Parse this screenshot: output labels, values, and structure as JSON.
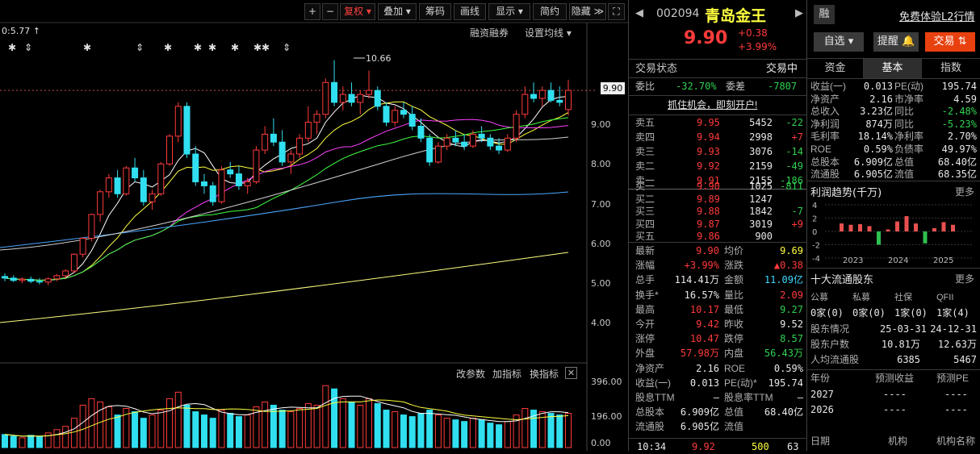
{
  "toolbar": {
    "plus": "+",
    "minus": "−",
    "buttons": [
      "复权",
      "叠加",
      "筹码",
      "画线",
      "显示",
      "简约",
      "隐藏"
    ],
    "expand_icon": "expand-icon"
  },
  "chart": {
    "max_label": "0:5.77",
    "peak_label": "10.66",
    "links": [
      "融资融券",
      "设置均线"
    ],
    "price_tag": "9.90",
    "y_ticks": [
      "9.00",
      "8.00",
      "7.00",
      "6.00",
      "5.00",
      "4.00"
    ],
    "volume_links": [
      "改参数",
      "加指标",
      "换指标"
    ],
    "volume_ticks": [
      "396.00",
      "196.00",
      "0.00"
    ],
    "candles": [
      [
        5.22,
        5.3,
        5.1,
        5.18
      ],
      [
        5.18,
        5.25,
        5.08,
        5.12
      ],
      [
        5.12,
        5.2,
        5.05,
        5.15
      ],
      [
        5.15,
        5.22,
        5.05,
        5.1
      ],
      [
        5.1,
        5.18,
        5.02,
        5.08
      ],
      [
        5.08,
        5.2,
        5.0,
        5.16
      ],
      [
        5.16,
        5.28,
        5.1,
        5.24
      ],
      [
        5.24,
        5.4,
        5.18,
        5.36
      ],
      [
        5.36,
        5.8,
        5.3,
        5.78
      ],
      [
        5.78,
        6.2,
        5.7,
        6.18
      ],
      [
        6.18,
        6.8,
        6.1,
        6.78
      ],
      [
        6.78,
        7.4,
        6.6,
        7.35
      ],
      [
        7.35,
        7.8,
        7.2,
        7.7
      ],
      [
        7.7,
        7.9,
        7.2,
        7.3
      ],
      [
        7.3,
        8.0,
        7.25,
        7.95
      ],
      [
        7.95,
        8.2,
        7.6,
        7.7
      ],
      [
        7.7,
        7.9,
        7.0,
        7.1
      ],
      [
        7.1,
        7.4,
        6.9,
        7.3
      ],
      [
        7.3,
        8.1,
        7.25,
        8.05
      ],
      [
        8.05,
        8.8,
        8.0,
        8.75
      ],
      [
        8.75,
        9.6,
        8.6,
        9.5
      ],
      [
        9.5,
        9.6,
        8.2,
        8.3
      ],
      [
        8.3,
        8.5,
        7.5,
        7.6
      ],
      [
        7.6,
        7.8,
        7.3,
        7.5
      ],
      [
        7.5,
        7.6,
        7.0,
        7.1
      ],
      [
        7.1,
        8.0,
        7.05,
        7.9
      ],
      [
        7.9,
        8.1,
        7.7,
        7.8
      ],
      [
        7.8,
        8.0,
        7.4,
        7.5
      ],
      [
        7.5,
        7.7,
        7.3,
        7.6
      ],
      [
        7.6,
        8.5,
        7.55,
        8.4
      ],
      [
        8.4,
        9.0,
        8.3,
        8.8
      ],
      [
        8.8,
        9.2,
        8.5,
        8.6
      ],
      [
        8.6,
        8.9,
        8.0,
        8.1
      ],
      [
        8.1,
        8.4,
        7.8,
        8.3
      ],
      [
        8.3,
        8.8,
        8.2,
        8.7
      ],
      [
        8.7,
        9.5,
        8.6,
        9.1
      ],
      [
        9.1,
        9.4,
        8.8,
        9.3
      ],
      [
        9.3,
        10.2,
        9.2,
        10.1
      ],
      [
        10.1,
        10.66,
        9.5,
        9.6
      ],
      [
        9.6,
        10.0,
        9.4,
        9.8
      ],
      [
        9.8,
        10.1,
        9.5,
        9.6
      ],
      [
        9.6,
        9.9,
        9.3,
        9.8
      ],
      [
        9.8,
        10.4,
        9.7,
        9.9
      ],
      [
        9.9,
        10.0,
        9.4,
        9.5
      ],
      [
        9.5,
        9.6,
        9.0,
        9.1
      ],
      [
        9.1,
        9.5,
        9.0,
        9.4
      ],
      [
        9.4,
        9.6,
        9.2,
        9.3
      ],
      [
        9.3,
        9.5,
        8.9,
        9.0
      ],
      [
        9.0,
        9.2,
        8.6,
        8.7
      ],
      [
        8.7,
        8.8,
        8.0,
        8.1
      ],
      [
        8.1,
        8.6,
        8.05,
        8.5
      ],
      [
        8.5,
        8.8,
        8.4,
        8.7
      ],
      [
        8.7,
        8.9,
        8.5,
        8.6
      ],
      [
        8.6,
        8.8,
        8.4,
        8.5
      ],
      [
        8.5,
        8.9,
        8.45,
        8.8
      ],
      [
        8.8,
        9.0,
        8.6,
        8.7
      ],
      [
        8.7,
        8.8,
        8.4,
        8.5
      ],
      [
        8.5,
        8.7,
        8.3,
        8.4
      ],
      [
        8.4,
        8.8,
        8.35,
        8.7
      ],
      [
        8.7,
        9.4,
        8.6,
        9.3
      ],
      [
        9.3,
        10.0,
        9.2,
        9.8
      ],
      [
        9.8,
        10.1,
        9.6,
        9.7
      ],
      [
        9.7,
        10.0,
        9.5,
        9.9
      ],
      [
        9.9,
        10.1,
        9.6,
        9.65
      ],
      [
        9.65,
        10.0,
        9.5,
        9.6
      ],
      [
        9.42,
        10.17,
        9.27,
        9.9
      ]
    ],
    "volumes": [
      80,
      70,
      60,
      75,
      65,
      90,
      110,
      130,
      180,
      260,
      300,
      280,
      250,
      200,
      240,
      220,
      180,
      200,
      230,
      300,
      340,
      260,
      220,
      200,
      180,
      230,
      210,
      190,
      200,
      250,
      280,
      260,
      230,
      220,
      240,
      270,
      260,
      380,
      360,
      300,
      280,
      260,
      300,
      270,
      230,
      220,
      200,
      190,
      210,
      230,
      200,
      180,
      170,
      160,
      180,
      170,
      150,
      140,
      160,
      200,
      240,
      230,
      220,
      210,
      200,
      210
    ]
  },
  "quote": {
    "code": "002094",
    "name": "青岛金王",
    "badge": "融",
    "l2_link": "免费体验L2行情",
    "price": "9.90",
    "change": "+0.38",
    "change_pct": "+3.99%",
    "buttons": [
      "自选",
      "提醒",
      "交易"
    ],
    "status_label": "交易状态",
    "status_value": "交易中",
    "wb_label": "委比",
    "wb_value": "-32.70%",
    "wc_label": "委差",
    "wc_value": "-7807",
    "promo": "抓住机会，即刻开户!",
    "asks": [
      {
        "label": "卖五",
        "price": "9.95",
        "vol": "5452",
        "delta": "-22"
      },
      {
        "label": "卖四",
        "price": "9.94",
        "vol": "2998",
        "delta": "+7"
      },
      {
        "label": "卖三",
        "price": "9.93",
        "vol": "3076",
        "delta": "-14"
      },
      {
        "label": "卖二",
        "price": "9.92",
        "vol": "2159",
        "delta": "-49"
      },
      {
        "label": "卖一",
        "price": "9.91",
        "vol": "2155",
        "delta": "-186"
      }
    ],
    "bids": [
      {
        "label": "买一",
        "price": "9.90",
        "vol": "1025",
        "delta": "-811"
      },
      {
        "label": "买二",
        "price": "9.89",
        "vol": "1247",
        "delta": ""
      },
      {
        "label": "买三",
        "price": "9.88",
        "vol": "1842",
        "delta": "-7"
      },
      {
        "label": "买四",
        "price": "9.87",
        "vol": "3019",
        "delta": "+9"
      },
      {
        "label": "买五",
        "price": "9.86",
        "vol": "900",
        "delta": ""
      }
    ],
    "stats": [
      [
        "最新",
        "9.90",
        "均价",
        "9.69"
      ],
      [
        "涨幅",
        "+3.99%",
        "涨跌",
        "▲0.38"
      ],
      [
        "总手",
        "114.41万",
        "金额",
        "11.09亿"
      ],
      [
        "换手*",
        "16.57%",
        "量比",
        "2.09"
      ],
      [
        "最高",
        "10.17",
        "最低",
        "9.27"
      ],
      [
        "今开",
        "9.42",
        "昨收",
        "9.52"
      ],
      [
        "涨停",
        "10.47",
        "跌停",
        "8.57"
      ],
      [
        "外盘",
        "57.98万",
        "内盘",
        "56.43万"
      ],
      [
        "净资产",
        "2.16",
        "ROE",
        "0.59%"
      ],
      [
        "收益(一)",
        "0.013",
        "PE(动)*",
        "195.74"
      ],
      [
        "股息TTM",
        "—",
        "股息率TTM",
        "—"
      ],
      [
        "总股本",
        "6.909亿",
        "总值",
        "68.40亿"
      ],
      [
        "流通股",
        "6.905亿",
        "流值",
        ""
      ]
    ],
    "tick": {
      "time": "10:34",
      "price": "9.92",
      "vol": "500",
      "num": "63"
    }
  },
  "fund": {
    "tabs": [
      "资金",
      "基本",
      "指数"
    ],
    "rows": [
      [
        "收益(一)",
        "0.013",
        "PE(动)",
        "195.74"
      ],
      [
        "净资产",
        "2.16",
        "市净率",
        "4.59"
      ],
      [
        "总收入",
        "3.23亿",
        "同比",
        "-2.48%"
      ],
      [
        "净利润",
        "874万",
        "同比",
        "-5.23%"
      ],
      [
        "毛利率",
        "18.14%",
        "净利率",
        "2.70%"
      ],
      [
        "ROE",
        "0.59%",
        "负债率",
        "49.97%"
      ],
      [
        "总股本",
        "6.909亿",
        "总值",
        "68.40亿"
      ],
      [
        "流通股",
        "6.905亿",
        "流值",
        "68.35亿"
      ]
    ],
    "profit_title": "利润趋势(千万)",
    "more": "更多",
    "profit_y": [
      "4",
      "2",
      "0",
      "-2",
      "-4"
    ],
    "profit_years": [
      "2023",
      "2024",
      "2025"
    ],
    "profit_values": [
      1.2,
      1.0,
      1.1,
      0.8,
      -2.0,
      0.3,
      1.5,
      2.3,
      1.2,
      -1.8,
      0.5,
      1.4,
      1.0
    ],
    "holders_title": "十大流通股东",
    "holders_heads": [
      "公募",
      "私募",
      "社保",
      "QFII"
    ],
    "holders_vals": [
      "0家(0)",
      "0家(0)",
      "1家(0)",
      "1家(4)"
    ],
    "holder_rows": [
      [
        "股东情况",
        "25-03-31",
        "24-12-31"
      ],
      [
        "股东户数",
        "10.81万",
        "12.63万"
      ],
      [
        "人均流通股",
        "6385",
        "5467"
      ]
    ],
    "forecast_heads": [
      "年份",
      "预测收益",
      "预测PE"
    ],
    "forecast_rows": [
      [
        "2027",
        "----",
        "----"
      ],
      [
        "2026",
        "----",
        "----"
      ]
    ],
    "bottom_labels": [
      "日期",
      "机构",
      "机构名称"
    ]
  }
}
